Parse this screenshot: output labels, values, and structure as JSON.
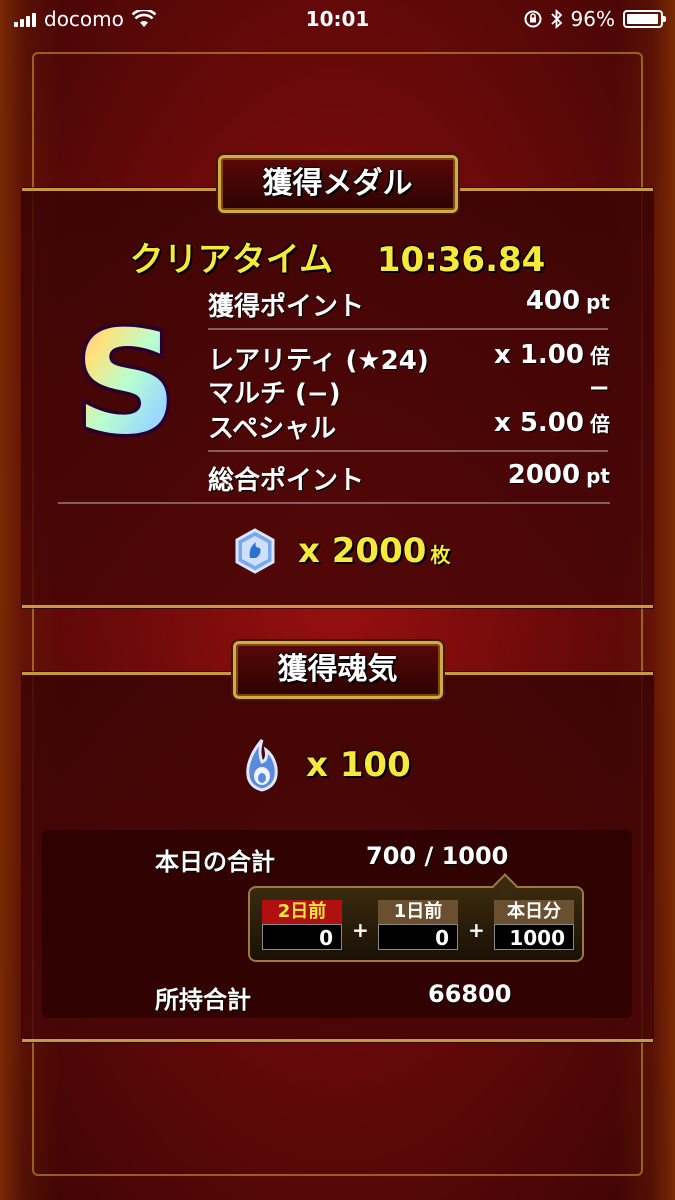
{
  "status_bar": {
    "carrier": "docomo",
    "time": "10:01",
    "battery": "96%",
    "battery_level": 0.96
  },
  "medal_panel": {
    "title": "獲得メダル",
    "clear_time_label": "クリアタイム",
    "clear_time": "10:36.84",
    "rank": "S",
    "rows": [
      {
        "label": "獲得ポイント",
        "value": "400",
        "unit": "pt"
      },
      {
        "label": "レアリティ (★24)",
        "value": "x 1.00",
        "unit": "倍"
      },
      {
        "label": "マルチ (−)",
        "value": "−",
        "unit": ""
      },
      {
        "label": "スペシャル",
        "value": "x 5.00",
        "unit": "倍"
      },
      {
        "label": "総合ポイント",
        "value": "2000",
        "unit": "pt"
      }
    ],
    "medal_amount": "x 2000",
    "medal_unit": "枚",
    "medal_icon": "medal-icon"
  },
  "soul_panel": {
    "title": "獲得魂気",
    "soul_amount": "x 100",
    "soul_icon": "soul-flame-icon",
    "today_total_label": "本日の合計",
    "today_total_value": "700 / 1000",
    "breakdown": [
      {
        "label": "2日前",
        "value": "0"
      },
      {
        "label": "1日前",
        "value": "0"
      },
      {
        "label": "本日分",
        "value": "1000"
      }
    ],
    "owned_total_label": "所持合計",
    "owned_total_value": "66800"
  },
  "colors": {
    "accent_yellow": "#f8e83a",
    "frame_gold": "#d8a847",
    "background_red": "#6e0a0a"
  }
}
